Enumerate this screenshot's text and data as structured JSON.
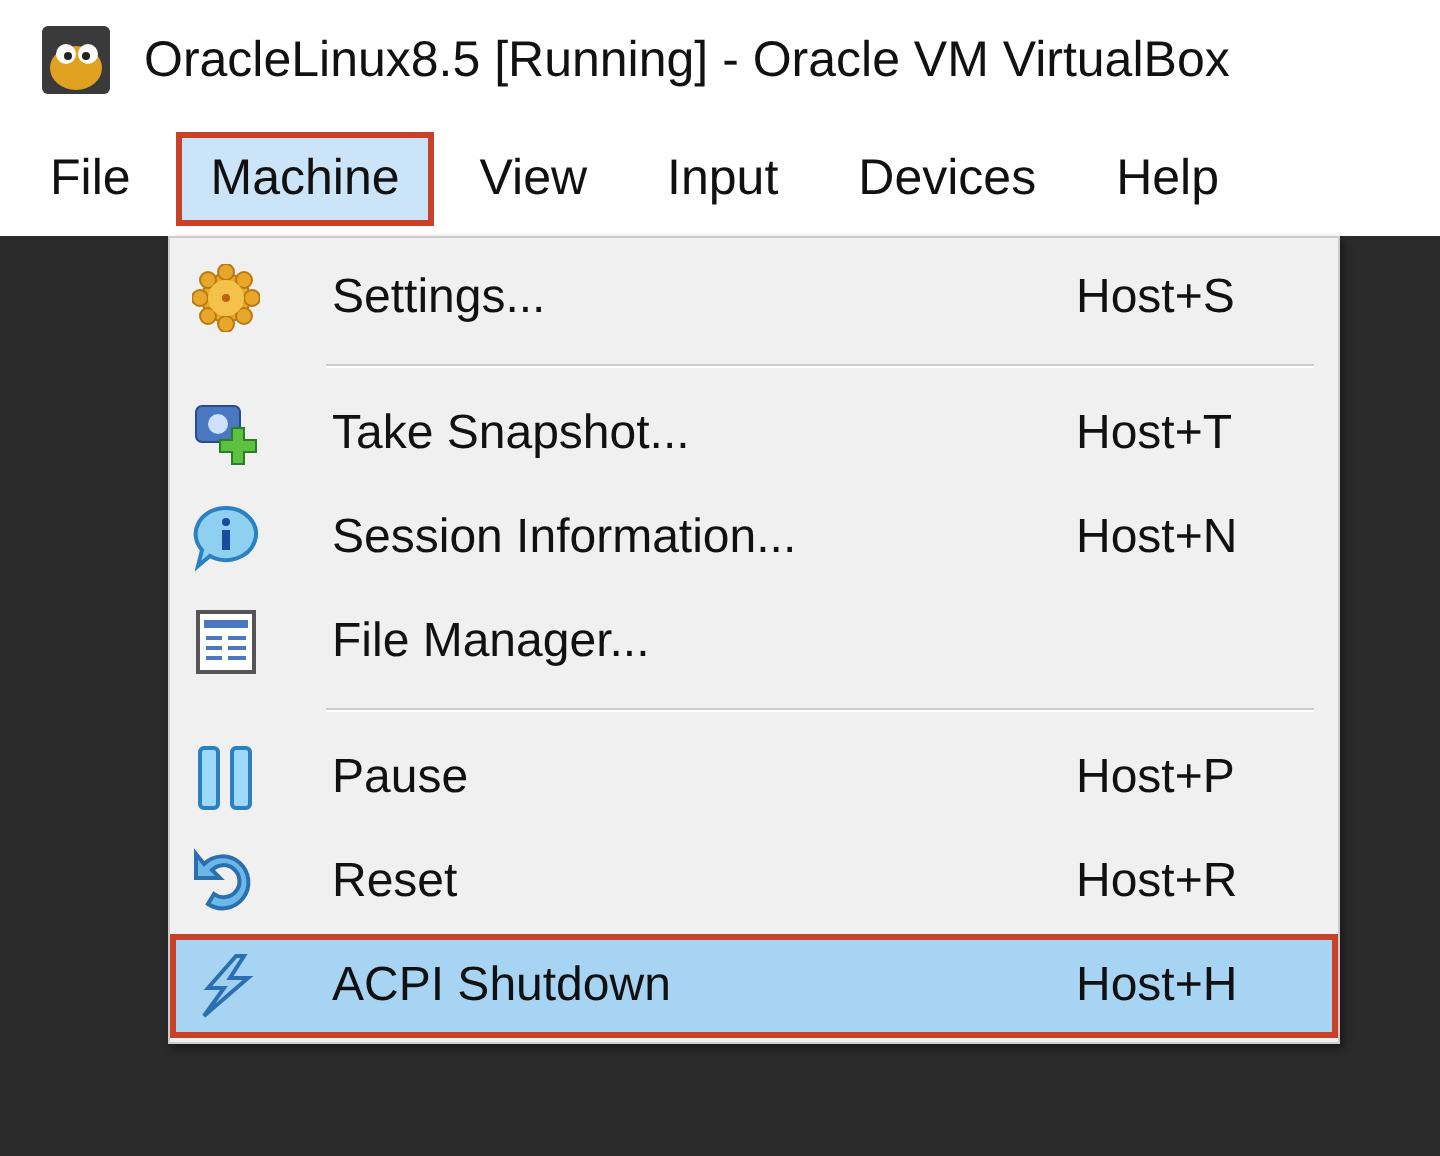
{
  "window": {
    "title": "OracleLinux8.5 [Running] - Oracle VM VirtualBox"
  },
  "menubar": [
    {
      "label": "File",
      "selected": false,
      "annotated": false
    },
    {
      "label": "Machine",
      "selected": true,
      "annotated": true
    },
    {
      "label": "View",
      "selected": false,
      "annotated": false
    },
    {
      "label": "Input",
      "selected": false,
      "annotated": false
    },
    {
      "label": "Devices",
      "selected": false,
      "annotated": false
    },
    {
      "label": "Help",
      "selected": false,
      "annotated": false
    }
  ],
  "menu": [
    {
      "kind": "item",
      "label": "Settings...",
      "shortcut": "Host+S",
      "selected": false,
      "annotated": false
    },
    {
      "kind": "separator"
    },
    {
      "kind": "item",
      "label": "Take Snapshot...",
      "shortcut": "Host+T",
      "selected": false,
      "annotated": false
    },
    {
      "kind": "item",
      "label": "Session Information...",
      "shortcut": "Host+N",
      "selected": false,
      "annotated": false
    },
    {
      "kind": "item",
      "label": "File Manager...",
      "selected": false,
      "annotated": false
    },
    {
      "kind": "separator"
    },
    {
      "kind": "item",
      "label": "Pause",
      "shortcut": "Host+P",
      "selected": false,
      "annotated": false
    },
    {
      "kind": "item",
      "label": "Reset",
      "shortcut": "Host+R",
      "selected": false,
      "annotated": false
    },
    {
      "kind": "item",
      "label": "ACPI Shutdown",
      "shortcut": "Host+H",
      "selected": true,
      "annotated": true
    }
  ]
}
